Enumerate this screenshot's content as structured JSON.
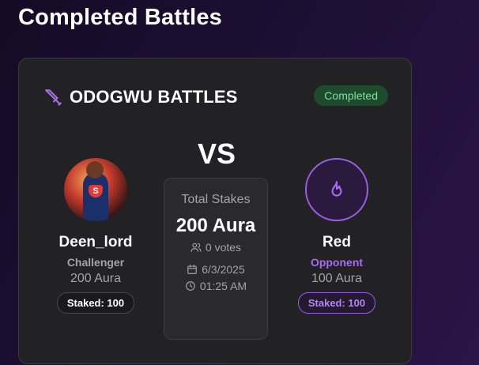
{
  "page": {
    "title": "Completed Battles"
  },
  "battle": {
    "title": "ODOGWU BATTLES",
    "status": "Completed",
    "vs_label": "VS",
    "challenger": {
      "name": "Deen_lord",
      "role": "Challenger",
      "aura": "200 Aura",
      "staked": "Staked: 100",
      "avatar": "superhero-avatar"
    },
    "opponent": {
      "name": "Red",
      "role": "Opponent",
      "aura": "100 Aura",
      "staked": "Staked: 100",
      "avatar": "flame-icon"
    },
    "stakes": {
      "label": "Total Stakes",
      "value": "200 Aura",
      "votes": "0 votes",
      "date": "6/3/2025",
      "time": "01:25 AM"
    }
  },
  "colors": {
    "accent_purple": "#9a5fe6",
    "completed_green": "#7ee29c",
    "completed_bg": "#1e4a2d",
    "card_bg": "#222224"
  }
}
